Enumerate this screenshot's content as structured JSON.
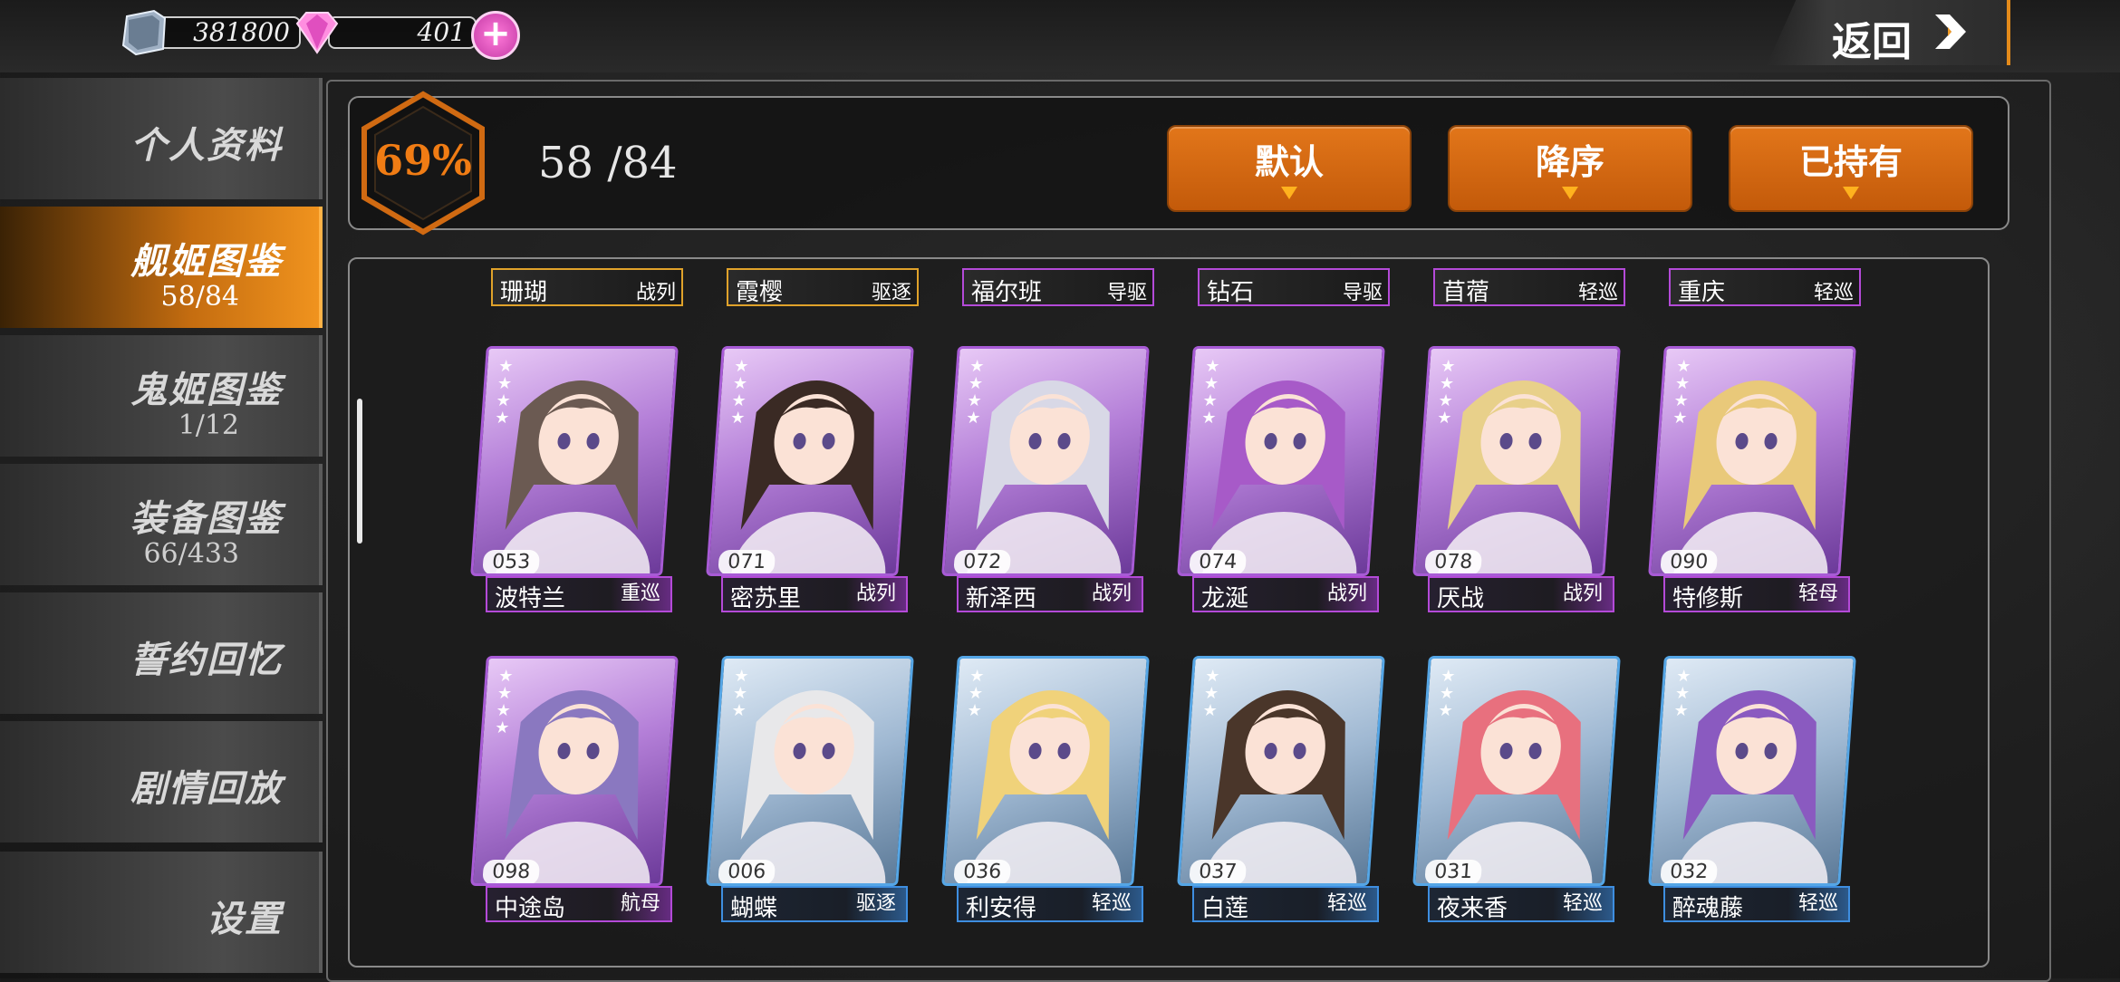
{
  "resources": {
    "silver": "381800",
    "gems": "401",
    "add_symbol": "+"
  },
  "back_label": "返回",
  "sidebar": [
    {
      "label": "个人资料",
      "count": ""
    },
    {
      "label": "舰姬图鉴",
      "count": "58/84",
      "active": true
    },
    {
      "label": "鬼姬图鉴",
      "count": "1/12"
    },
    {
      "label": "装备图鉴",
      "count": "66/433"
    },
    {
      "label": "誓约回忆",
      "count": ""
    },
    {
      "label": "剧情回放",
      "count": ""
    },
    {
      "label": "设置",
      "count": ""
    }
  ],
  "progress": {
    "percent": "69%",
    "collected": "58 /84"
  },
  "sort_buttons": [
    "默认",
    "降序",
    "已持有"
  ],
  "top_row": [
    {
      "name": "珊瑚",
      "type": "战列",
      "frame": "gold"
    },
    {
      "name": "霞樱",
      "type": "驱逐",
      "frame": "gold"
    },
    {
      "name": "福尔班",
      "type": "导驱",
      "frame": "purple"
    },
    {
      "name": "钻石",
      "type": "导驱",
      "frame": "purple"
    },
    {
      "name": "苜蓿",
      "type": "轻巡",
      "frame": "purple"
    },
    {
      "name": "重庆",
      "type": "轻巡",
      "frame": "purple"
    }
  ],
  "cards": [
    {
      "no": "053",
      "name": "波特兰",
      "type": "重巡",
      "rarity": "purple",
      "stars": 4
    },
    {
      "no": "071",
      "name": "密苏里",
      "type": "战列",
      "rarity": "purple",
      "stars": 4
    },
    {
      "no": "072",
      "name": "新泽西",
      "type": "战列",
      "rarity": "purple",
      "stars": 4
    },
    {
      "no": "074",
      "name": "龙涎",
      "type": "战列",
      "rarity": "purple",
      "stars": 4
    },
    {
      "no": "078",
      "name": "厌战",
      "type": "战列",
      "rarity": "purple",
      "stars": 4
    },
    {
      "no": "090",
      "name": "特修斯",
      "type": "轻母",
      "rarity": "purple",
      "stars": 4
    },
    {
      "no": "098",
      "name": "中途岛",
      "type": "航母",
      "rarity": "purple",
      "stars": 4
    },
    {
      "no": "006",
      "name": "蝴蝶",
      "type": "驱逐",
      "rarity": "blue",
      "stars": 3
    },
    {
      "no": "036",
      "name": "利安得",
      "type": "轻巡",
      "rarity": "blue",
      "stars": 3
    },
    {
      "no": "037",
      "name": "白莲",
      "type": "轻巡",
      "rarity": "blue",
      "stars": 3
    },
    {
      "no": "031",
      "name": "夜来香",
      "type": "轻巡",
      "rarity": "blue",
      "stars": 3
    },
    {
      "no": "032",
      "name": "醉魂藤",
      "type": "轻巡",
      "rarity": "blue",
      "stars": 3
    }
  ],
  "colors": {
    "accent_orange": "#e2761a",
    "purple_frame": "#b44ad8",
    "blue_frame": "#3e8ee0",
    "gold_frame": "#e0a22a"
  }
}
